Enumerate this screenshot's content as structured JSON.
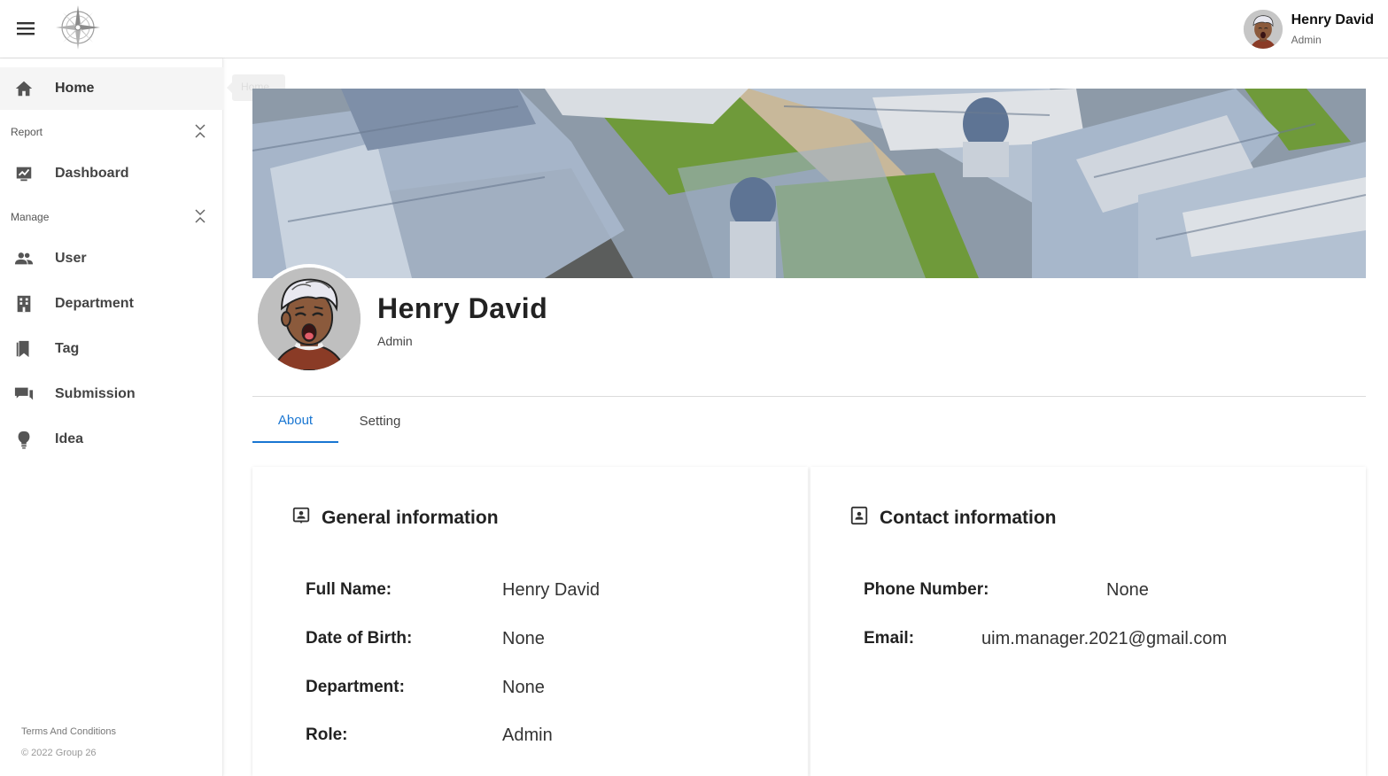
{
  "header": {
    "user_name": "Henry David",
    "user_role": "Admin",
    "menu_icon": "hamburger-menu-icon",
    "logo_icon": "compass-logo-icon"
  },
  "sidebar": {
    "home": {
      "label": "Home",
      "icon": "home-icon",
      "tooltip": "Home"
    },
    "report": {
      "label": "Report",
      "items": [
        {
          "label": "Dashboard",
          "icon": "dashboard-chart-icon"
        }
      ]
    },
    "manage": {
      "label": "Manage",
      "items": [
        {
          "label": "User",
          "icon": "users-icon"
        },
        {
          "label": "Department",
          "icon": "building-icon"
        },
        {
          "label": "Tag",
          "icon": "bookmark-icon"
        },
        {
          "label": "Submission",
          "icon": "chat-icon"
        },
        {
          "label": "Idea",
          "icon": "lightbulb-icon"
        }
      ]
    },
    "terms": "Terms And Conditions",
    "copyright": "© 2022 Group 26"
  },
  "profile": {
    "name": "Henry David",
    "role": "Admin",
    "tabs": [
      {
        "label": "About",
        "active": true
      },
      {
        "label": "Setting",
        "active": false
      }
    ]
  },
  "general": {
    "title": "General information",
    "rows": [
      {
        "label": "Full Name:",
        "value": "Henry David"
      },
      {
        "label": "Date of Birth:",
        "value": "None"
      },
      {
        "label": "Department:",
        "value": "None"
      },
      {
        "label": "Role:",
        "value": "Admin"
      }
    ]
  },
  "contact": {
    "title": "Contact information",
    "rows": [
      {
        "label": "Phone Number:",
        "value": "None"
      },
      {
        "label": "Email:",
        "value": "uim.manager.2021@gmail.com"
      }
    ]
  },
  "colors": {
    "accent": "#1976d2",
    "active_bg": "#f5f5f5"
  }
}
